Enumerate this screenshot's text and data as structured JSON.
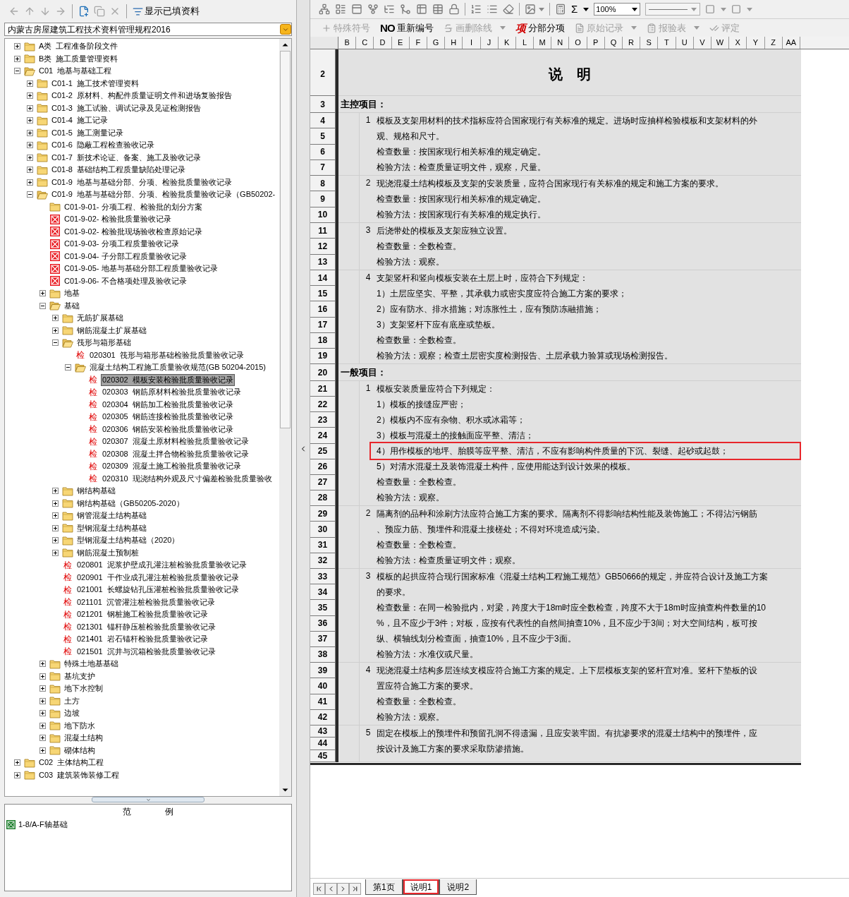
{
  "left_toolbar": {
    "filter_label": "显示已填资料"
  },
  "standard": "内蒙古房屋建筑工程技术资料管理规程2016",
  "tree": [
    {
      "label": "A类  工程准备阶段文件",
      "kind": "folder",
      "expanded": false,
      "selected": false
    },
    {
      "label": "B类  施工质量管理资料",
      "kind": "folder",
      "expanded": false,
      "selected": false
    },
    {
      "label": "C01  地基与基础工程",
      "kind": "folder",
      "expanded": true,
      "selected": false,
      "children": [
        {
          "label": "C01-1  施工技术管理资料",
          "kind": "folder",
          "expanded": false,
          "selected": false
        },
        {
          "label": "C01-2  原材料、构配件质量证明文件和进场复验报告",
          "kind": "folder",
          "expanded": false,
          "selected": false
        },
        {
          "label": "C01-3  施工试验、调试记录及见证检测报告",
          "kind": "folder",
          "expanded": false,
          "selected": false
        },
        {
          "label": "C01-4  施工记录",
          "kind": "folder",
          "expanded": false,
          "selected": false
        },
        {
          "label": "C01-5  施工测量记录",
          "kind": "folder",
          "expanded": false,
          "selected": false
        },
        {
          "label": "C01-6  隐蔽工程检查验收记录",
          "kind": "folder",
          "expanded": false,
          "selected": false
        },
        {
          "label": "C01-7  新技术论证、备案、施工及验收记录",
          "kind": "folder",
          "expanded": false,
          "selected": false
        },
        {
          "label": "C01-8  基础结构工程质量缺陷处理记录",
          "kind": "folder",
          "expanded": false,
          "selected": false
        },
        {
          "label": "C01-9  地基与基础分部、分项、检验批质量验收记录",
          "kind": "folder",
          "expanded": false,
          "selected": false
        },
        {
          "label": "C01-9  地基与基础分部、分项、检验批质量验收记录（GB50202-",
          "kind": "folder",
          "expanded": true,
          "selected": false,
          "children": [
            {
              "label": "C01-9-01- 分项工程、检验批的划分方案",
              "kind": "plain_folder",
              "selected": false
            },
            {
              "label": "C01-9-02- 检验批质量验收记录",
              "kind": "form",
              "selected": false
            },
            {
              "label": "C01-9-02- 检验批现场验收检查原始记录",
              "kind": "form",
              "selected": false
            },
            {
              "label": "C01-9-03- 分项工程质量验收记录",
              "kind": "form",
              "selected": false
            },
            {
              "label": "C01-9-04- 子分部工程质量验收记录",
              "kind": "form",
              "selected": false
            },
            {
              "label": "C01-9-05- 地基与基础分部工程质量验收记录",
              "kind": "form",
              "selected": false
            },
            {
              "label": "C01-9-06- 不合格项处理及验收记录",
              "kind": "form",
              "selected": false
            },
            {
              "label": "地基",
              "kind": "folder",
              "expanded": false,
              "selected": false
            },
            {
              "label": "基础",
              "kind": "folder",
              "expanded": true,
              "selected": false,
              "children": [
                {
                  "label": "无筋扩展基础",
                  "kind": "folder",
                  "expanded": false,
                  "selected": false
                },
                {
                  "label": "钢筋混凝土扩展基础",
                  "kind": "folder",
                  "expanded": false,
                  "selected": false
                },
                {
                  "label": "筏形与箱形基础",
                  "kind": "folder",
                  "expanded": true,
                  "selected": false,
                  "children": [
                    {
                      "label": "020301  筏形与箱形基础检验批质量验收记录",
                      "kind": "check",
                      "badge": "检",
                      "selected": false
                    },
                    {
                      "label": "混凝土结构工程施工质量验收规范(GB 50204-2015)",
                      "kind": "folder",
                      "expanded": true,
                      "selected": false,
                      "children": [
                        {
                          "label": "020302  模板安装检验批质量验收记录",
                          "kind": "check",
                          "badge": "检",
                          "selected": true
                        },
                        {
                          "label": "020303  钢筋原材料检验批质量验收记录",
                          "kind": "check",
                          "badge": "检",
                          "selected": false
                        },
                        {
                          "label": "020304  钢筋加工检验批质量验收记录",
                          "kind": "check",
                          "badge": "检",
                          "selected": false
                        },
                        {
                          "label": "020305  钢筋连接检验批质量验收记录",
                          "kind": "check",
                          "badge": "检",
                          "selected": false
                        },
                        {
                          "label": "020306  钢筋安装检验批质量验收记录",
                          "kind": "check",
                          "badge": "检",
                          "selected": false
                        },
                        {
                          "label": "020307  混凝土原材料检验批质量验收记录",
                          "kind": "check",
                          "badge": "检",
                          "selected": false
                        },
                        {
                          "label": "020308  混凝土拌合物检验批质量验收记录",
                          "kind": "check",
                          "badge": "检",
                          "selected": false
                        },
                        {
                          "label": "020309  混凝土施工检验批质量验收记录",
                          "kind": "check",
                          "badge": "检",
                          "selected": false
                        },
                        {
                          "label": "020310  现浇结构外观及尺寸偏差检验批质量验收",
                          "kind": "check",
                          "badge": "检",
                          "selected": false
                        }
                      ]
                    }
                  ]
                },
                {
                  "label": "钢结构基础",
                  "kind": "folder",
                  "expanded": false,
                  "selected": false
                },
                {
                  "label": "钢结构基础（GB50205-2020）",
                  "kind": "folder",
                  "expanded": false,
                  "selected": false
                },
                {
                  "label": "钢管混凝土结构基础",
                  "kind": "folder",
                  "expanded": false,
                  "selected": false
                },
                {
                  "label": "型钢混凝土结构基础",
                  "kind": "folder",
                  "expanded": false,
                  "selected": false
                },
                {
                  "label": "型钢混凝土结构基础（2020）",
                  "kind": "folder",
                  "expanded": false,
                  "selected": false
                },
                {
                  "label": "钢筋混凝土预制桩",
                  "kind": "folder",
                  "expanded": false,
                  "selected": false
                },
                {
                  "label": "020801  泥浆护壁成孔灌注桩检验批质量验收记录",
                  "kind": "check",
                  "badge": "检",
                  "selected": false
                },
                {
                  "label": "020901  干作业成孔灌注桩检验批质量验收记录",
                  "kind": "check",
                  "badge": "检",
                  "selected": false
                },
                {
                  "label": "021001  长螺旋钻孔压灌桩检验批质量验收记录",
                  "kind": "check",
                  "badge": "检",
                  "selected": false
                },
                {
                  "label": "021101  沉管灌注桩检验批质量验收记录",
                  "kind": "check",
                  "badge": "检",
                  "selected": false
                },
                {
                  "label": "021201  钢桩施工检验批质量验收记录",
                  "kind": "check",
                  "badge": "检",
                  "selected": false
                },
                {
                  "label": "021301  锚杆静压桩检验批质量验收记录",
                  "kind": "check",
                  "badge": "检",
                  "selected": false
                },
                {
                  "label": "021401  岩石锚杆检验批质量验收记录",
                  "kind": "check",
                  "badge": "检",
                  "selected": false
                },
                {
                  "label": "021501  沉井与沉箱检验批质量验收记录",
                  "kind": "check",
                  "badge": "检",
                  "selected": false
                }
              ]
            },
            {
              "label": "特殊土地基基础",
              "kind": "folder",
              "expanded": false,
              "selected": false
            },
            {
              "label": "基坑支护",
              "kind": "folder",
              "expanded": false,
              "selected": false
            },
            {
              "label": "地下水控制",
              "kind": "folder",
              "expanded": false,
              "selected": false
            },
            {
              "label": "土方",
              "kind": "folder",
              "expanded": false,
              "selected": false
            },
            {
              "label": "边坡",
              "kind": "folder",
              "expanded": false,
              "selected": false
            },
            {
              "label": "地下防水",
              "kind": "folder",
              "expanded": false,
              "selected": false
            },
            {
              "label": "混凝土结构",
              "kind": "folder",
              "expanded": false,
              "selected": false
            },
            {
              "label": "砌体结构",
              "kind": "folder",
              "expanded": false,
              "selected": false
            }
          ]
        }
      ]
    },
    {
      "label": "C02  主体结构工程",
      "kind": "folder",
      "expanded": false,
      "selected": false
    },
    {
      "label": "C03  建筑装饰装修工程",
      "kind": "folder",
      "expanded": false,
      "selected": false
    }
  ],
  "legend": {
    "title": "范　　　　例",
    "items": [
      {
        "label": "1-8/A-F轴基础"
      }
    ]
  },
  "format_toolbar": {
    "sum_label": "Σ",
    "zoom": "100%"
  },
  "edit_toolbar": [
    {
      "kind": "symbol",
      "label": "特殊符号",
      "disabled": true,
      "menu": false
    },
    {
      "kind": "renumber",
      "icon_text": "NO",
      "label": "重新编号",
      "disabled": false,
      "menu": false
    },
    {
      "kind": "strike",
      "label": "画删除线",
      "disabled": true,
      "menu": true
    },
    {
      "kind": "section",
      "icon_text": "项",
      "label": "分部分项",
      "disabled": false,
      "menu": false
    },
    {
      "kind": "record",
      "label": "原始记录",
      "disabled": true,
      "menu": true
    },
    {
      "kind": "report",
      "label": "报验表",
      "disabled": true,
      "menu": true
    },
    {
      "kind": "rate",
      "label": "评定",
      "disabled": true,
      "menu": false
    }
  ],
  "sheet": {
    "columns": [
      "B",
      "C",
      "D",
      "E",
      "F",
      "G",
      "H",
      "I",
      "J",
      "K",
      "L",
      "M",
      "N",
      "O",
      "P",
      "Q",
      "R",
      "S",
      "T",
      "U",
      "V",
      "W",
      "X",
      "Y",
      "Z",
      "AA"
    ],
    "title_row": "2",
    "title": "说　明",
    "sections": [
      {
        "row": "3",
        "heading": "主控项目：",
        "items": [
          {
            "number": "1",
            "rows": [
              "4",
              "5",
              "6",
              "7"
            ],
            "lines": [
              {
                "text": "模板及支架用材料的技术指标应符合国家现行有关标准的规定。进场时应抽样检验模板和支架材料的外",
                "highlighted": false
              },
              {
                "text": "观、规格和尺寸。",
                "highlighted": false
              },
              {
                "text": "检查数量：按国家现行相关标准的规定确定。",
                "highlighted": false
              },
              {
                "text": "检验方法：检查质量证明文件，观察，尺量。",
                "highlighted": false
              }
            ]
          },
          {
            "number": "2",
            "rows": [
              "8",
              "9",
              "10"
            ],
            "lines": [
              {
                "text": "现浇混凝土结构模板及支架的安装质量，应符合国家现行有关标准的规定和施工方案的要求。",
                "highlighted": false
              },
              {
                "text": "检查数量：按国家现行相关标准的规定确定。",
                "highlighted": false
              },
              {
                "text": "检验方法：按国家现行有关标准的规定执行。",
                "highlighted": false
              }
            ]
          },
          {
            "number": "3",
            "rows": [
              "11",
              "12",
              "13"
            ],
            "lines": [
              {
                "text": "后浇带处的模板及支架应独立设置。",
                "highlighted": false
              },
              {
                "text": "检查数量：全数检查。",
                "highlighted": false
              },
              {
                "text": "检验方法：观察。",
                "highlighted": false
              }
            ]
          },
          {
            "number": "4",
            "rows": [
              "14",
              "15",
              "16",
              "17",
              "18",
              "19"
            ],
            "lines": [
              {
                "text": "支架竖杆和竖向模板安装在土层上时，应符合下列规定：",
                "highlighted": false
              },
              {
                "text": "1）土层应坚实、平整，其承载力或密实度应符合施工方案的要求；",
                "highlighted": false
              },
              {
                "text": "2）应有防水、排水措施；对冻胀性土，应有预防冻融措施；",
                "highlighted": false
              },
              {
                "text": "3）支架竖杆下应有底座或垫板。",
                "highlighted": false
              },
              {
                "text": "检查数量：全数检查。",
                "highlighted": false
              },
              {
                "text": "检验方法：观察；检查土层密实度检测报告、土层承载力验算或现场检测报告。",
                "highlighted": false
              }
            ]
          }
        ]
      },
      {
        "row": "20",
        "heading": "一般项目：",
        "items": [
          {
            "number": "1",
            "rows": [
              "21",
              "22",
              "23",
              "24",
              "25",
              "26",
              "27",
              "28"
            ],
            "lines": [
              {
                "text": "模板安装质量应符合下列规定：",
                "highlighted": false
              },
              {
                "text": "1）模板的接缝应严密；",
                "highlighted": false
              },
              {
                "text": "2）模板内不应有杂物、积水或冰霜等；",
                "highlighted": false
              },
              {
                "text": "3）模板与混凝土的接触面应平整、清洁；",
                "highlighted": false
              },
              {
                "text": "4）用作模板的地坪、胎膜等应平整、清洁，不应有影响构件质量的下沉、裂缝、起砂或起鼓；",
                "highlighted": true
              },
              {
                "text": "5）对清水混凝土及装饰混凝土构件，应使用能达到设计效果的模板。",
                "highlighted": false
              },
              {
                "text": "检查数量：全数检查。",
                "highlighted": false
              },
              {
                "text": "检验方法：观察。",
                "highlighted": false
              }
            ]
          },
          {
            "number": "2",
            "rows": [
              "29",
              "30",
              "31",
              "32"
            ],
            "lines": [
              {
                "text": "隔离剂的品种和涂刷方法应符合施工方案的要求。隔离剂不得影响结构性能及装饰施工；不得沾污钢筋",
                "highlighted": false
              },
              {
                "text": "、预应力筋、预埋件和混凝土接槎处；不得对环境造成污染。",
                "highlighted": false
              },
              {
                "text": "检查数量：全数检查。",
                "highlighted": false
              },
              {
                "text": "检验方法：检查质量证明文件；观察。",
                "highlighted": false
              }
            ]
          },
          {
            "number": "3",
            "rows": [
              "33",
              "34",
              "35",
              "36",
              "37",
              "38"
            ],
            "lines": [
              {
                "text": "模板的起拱应符合现行国家标准《混凝土结构工程施工规范》GB50666的规定，并应符合设计及施工方案",
                "highlighted": false
              },
              {
                "text": "的要求。",
                "highlighted": false
              },
              {
                "text": "检查数量：在同一检验批内，对梁，跨度大于18m时应全数检查，跨度不大于18m时应抽查构件数量的10",
                "highlighted": false
              },
              {
                "text": "%，且不应少于3件；对板，应按有代表性的自然间抽查10%，且不应少于3间；对大空间结构，板可按",
                "highlighted": false
              },
              {
                "text": "纵、横轴线划分检查面，抽查10%，且不应少于3面。",
                "highlighted": false
              },
              {
                "text": "检验方法：水准仪或尺量。",
                "highlighted": false
              }
            ]
          },
          {
            "number": "4",
            "rows": [
              "39",
              "40",
              "41",
              "42"
            ],
            "lines": [
              {
                "text": "现浇混凝土结构多层连续支模应符合施工方案的规定。上下层模板支架的竖杆宜对准。竖杆下垫板的设",
                "highlighted": false
              },
              {
                "text": "置应符合施工方案的要求。",
                "highlighted": false
              },
              {
                "text": "检查数量：全数检查。",
                "highlighted": false
              },
              {
                "text": "检验方法：观察。",
                "highlighted": false
              }
            ]
          },
          {
            "number": "5",
            "rows": [
              "43",
              "44",
              "45"
            ],
            "lines": [
              {
                "text": "固定在模板上的预埋件和预留孔洞不得遗漏，且应安装牢固。有抗渗要求的混凝土结构中的预埋件，应",
                "highlighted": false
              },
              {
                "text": "按设计及施工方案的要求采取防渗措施。",
                "highlighted": false
              }
            ]
          }
        ]
      }
    ]
  },
  "sheet_tabs": [
    {
      "label": "第1页",
      "selected": false,
      "highlighted": false
    },
    {
      "label": "说明1",
      "selected": true,
      "highlighted": true
    },
    {
      "label": "说明2",
      "selected": false,
      "highlighted": false
    }
  ]
}
